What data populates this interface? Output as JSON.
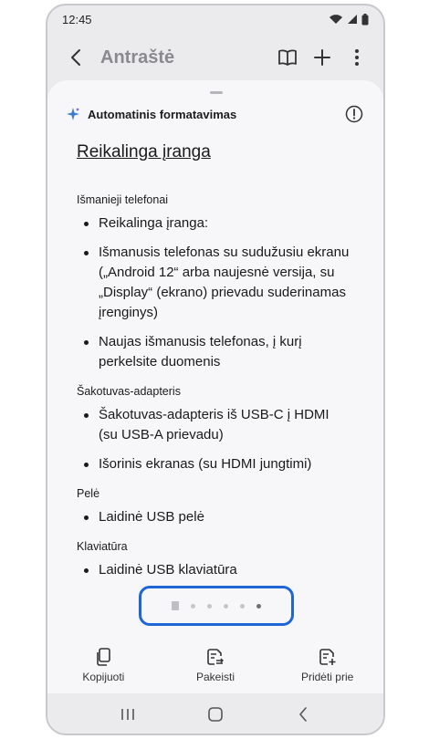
{
  "status": {
    "time": "12:45"
  },
  "appbar": {
    "title": "Antraštė"
  },
  "sheet": {
    "header_label": "Automatinis formatavimas"
  },
  "document": {
    "title": "Reikalinga įranga",
    "sections": [
      {
        "label": "Išmanieji telefonai",
        "items": [
          "Reikalinga įranga:",
          "Išmanusis telefonas su sudužusiu ekranu („Android 12“ arba naujesnė versija, su „Display“ (ekrano) prievadu suderinamas įrenginys)",
          "Naujas išmanusis telefonas, į kurį perkelsite duomenis"
        ]
      },
      {
        "label": "Šakotuvas-adapteris",
        "items": [
          "Šakotuvas-adapteris iš USB-C į HDMI (su USB-A prievadu)",
          "Išorinis ekranas (su HDMI jungtimi)"
        ]
      },
      {
        "label": "Pelė",
        "items": [
          "Laidinė USB pelė"
        ]
      },
      {
        "label": "Klaviatūra",
        "items": [
          "Laidinė USB klaviatūra"
        ]
      }
    ]
  },
  "pager": {
    "total_pages": 6,
    "active_index": 5
  },
  "actions": {
    "copy_label": "Kopijuoti",
    "replace_label": "Pakeisti",
    "add_label": "Pridėti prie"
  },
  "colors": {
    "highlight": "#1e66d6",
    "accent": "#3a7bd5"
  }
}
